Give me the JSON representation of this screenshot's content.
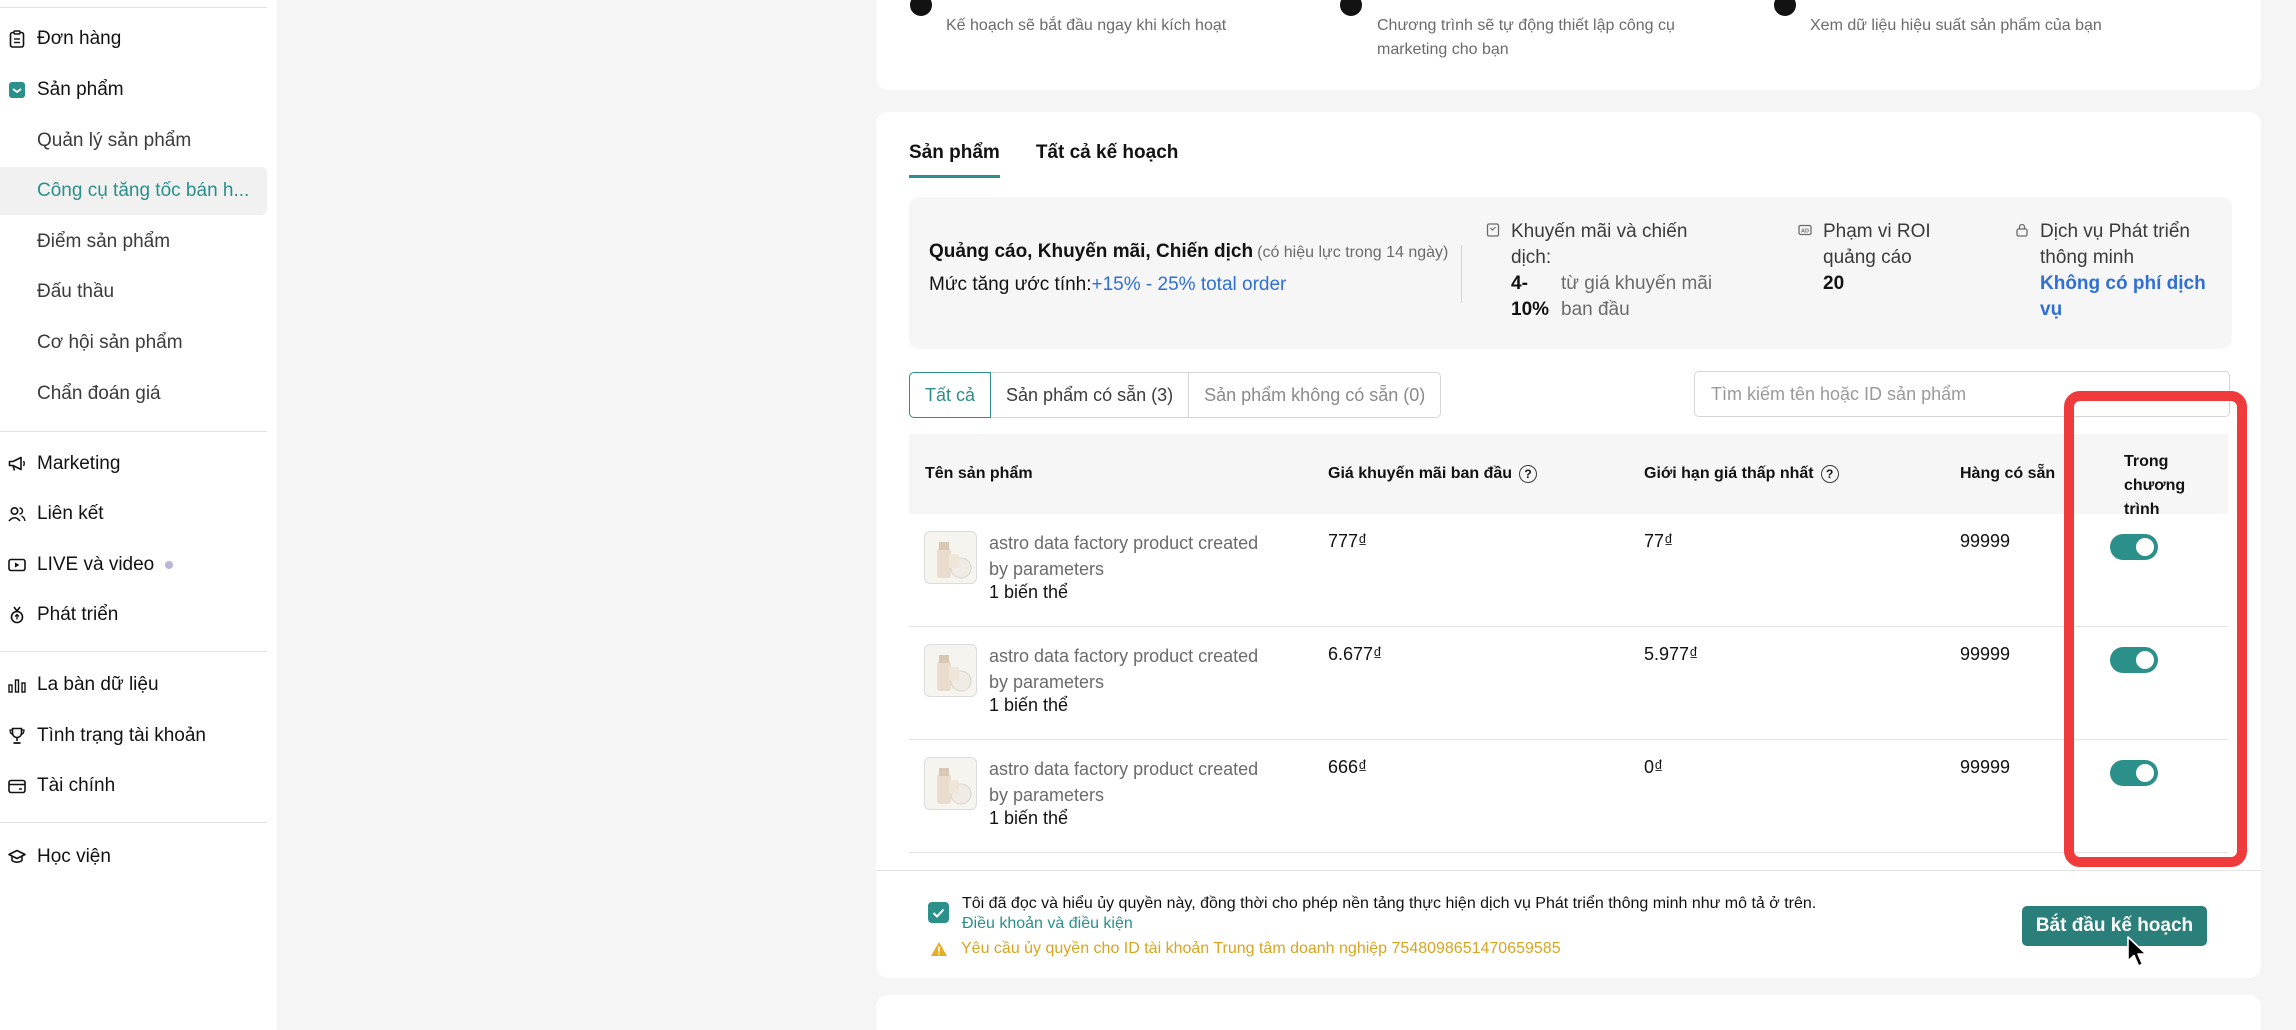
{
  "sidebar": {
    "items": [
      {
        "label": "Đơn hàng",
        "icon": "clipboard-icon"
      },
      {
        "label": "Sản phẩm",
        "icon": "product-box-icon"
      },
      {
        "label": "Quản lý sản phẩm"
      },
      {
        "label": "Công cụ tăng tốc bán h..."
      },
      {
        "label": "Điểm sản phẩm"
      },
      {
        "label": "Đấu thầu"
      },
      {
        "label": "Cơ hội sản phẩm"
      },
      {
        "label": "Chẩn đoán giá"
      },
      {
        "label": "Marketing",
        "icon": "megaphone-icon"
      },
      {
        "label": "Liên kết",
        "icon": "users-icon"
      },
      {
        "label": "LIVE và video",
        "icon": "video-icon"
      },
      {
        "label": "Phát triển",
        "icon": "growth-medal-icon"
      },
      {
        "label": "La bàn dữ liệu",
        "icon": "bar-chart-icon"
      },
      {
        "label": "Tình trạng tài khoản",
        "icon": "trophy-icon"
      },
      {
        "label": "Tài chính",
        "icon": "wallet-icon"
      },
      {
        "label": "Học viện",
        "icon": "graduation-cap-icon"
      }
    ]
  },
  "steps": [
    {
      "text": "Kế hoạch sẽ bắt đầu ngay khi kích hoạt"
    },
    {
      "text_line1": "Chương trình sẽ tự động thiết lập công cụ",
      "text_line2": "marketing cho bạn"
    },
    {
      "text": "Xem dữ liệu hiệu suất sản phẩm của bạn"
    }
  ],
  "tabs": [
    {
      "label": "Sản phẩm"
    },
    {
      "label": "Tất cả kế hoạch"
    }
  ],
  "info": {
    "title": "Quảng cáo, Khuyến mãi, Chiến dịch",
    "title_note": "(có hiệu lực trong 14 ngày)",
    "rate_label": "Mức tăng ước tính:",
    "rate_value": "+15% - 25% total order",
    "promo_label_1": "Khuyến mãi và chiến",
    "promo_label_2": "dịch:",
    "promo_value_1": "4-",
    "promo_value_2": "10%",
    "promo_note_1": "từ giá khuyến mãi",
    "promo_note_2": "ban đầu",
    "roi_label_1": "Phạm vi ROI",
    "roi_label_2": "quảng cáo",
    "roi_value": "20",
    "service_label_1": "Dịch vụ Phát triển",
    "service_label_2": "thông minh",
    "service_value": "Không có phí dịch vụ"
  },
  "filters": {
    "all": "Tất cả",
    "available": "Sản phẩm có sẵn (3)",
    "unavailable": "Sản phẩm không có sẵn (0)",
    "search_placeholder": "Tìm kiếm tên hoặc ID sản phẩm"
  },
  "table": {
    "headers": {
      "name": "Tên sản phẩm",
      "promo_price": "Giá khuyến mãi ban đầu",
      "min_price": "Giới hạn giá thấp nhất",
      "stock": "Hàng có sẵn",
      "in_program_1": "Trong chương",
      "in_program_2": "trình"
    },
    "rows": [
      {
        "name_1": "astro data factory product created",
        "name_2": "by parameters",
        "variants": "1 biến thể",
        "promo_price": "777₫",
        "min_price": "77₫",
        "stock": "99999",
        "in_program": true
      },
      {
        "name_1": "astro data factory product created",
        "name_2": "by parameters",
        "variants": "1 biến thể",
        "promo_price": "6.677₫",
        "min_price": "5.977₫",
        "stock": "99999",
        "in_program": true
      },
      {
        "name_1": "astro data factory product created",
        "name_2": "by parameters",
        "variants": "1 biến thể",
        "promo_price": "666₫",
        "min_price": "0₫",
        "stock": "99999",
        "in_program": true
      }
    ]
  },
  "footer": {
    "agree_text": "Tôi đã đọc và hiểu ủy quyền này, đồng thời cho phép nền tảng thực hiện dịch vụ Phát triển thông minh như mô tả ở trên.",
    "terms_link": "Điều khoản và điều kiện",
    "warning": "Yêu cầu ủy quyền cho ID tài khoản Trung tâm doanh nghiệp 7548098651470659585",
    "start_button": "Bắt đầu kế hoạch"
  },
  "colors": {
    "accent": "#2b8f8a",
    "button": "#2b7f7a",
    "link": "#2f6fd6",
    "warning": "#d9a520",
    "highlight": "#ef3b3b"
  }
}
